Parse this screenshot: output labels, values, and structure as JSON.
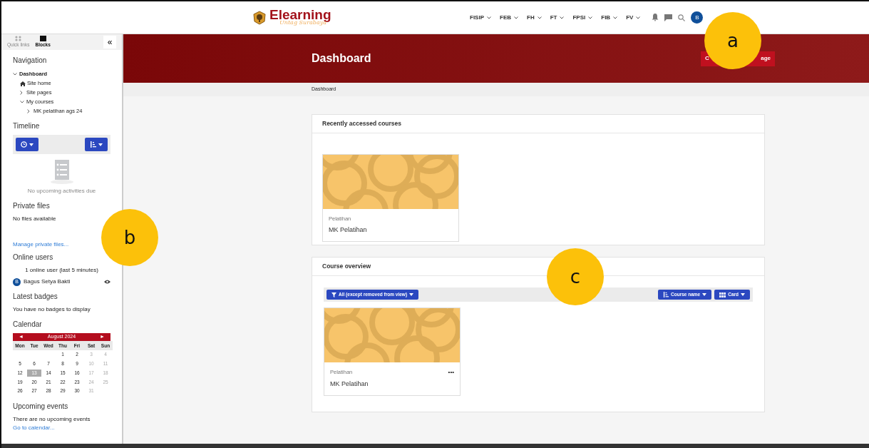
{
  "brand": {
    "name": "Elearning",
    "tagline": "Untag Surabaya"
  },
  "topnav": [
    {
      "label": "FISIP"
    },
    {
      "label": "FEB"
    },
    {
      "label": "FH"
    },
    {
      "label": "FT"
    },
    {
      "label": "FPSI"
    },
    {
      "label": "FIB"
    },
    {
      "label": "FV"
    }
  ],
  "user_avatar": "B",
  "drawer_tabs": [
    {
      "label": "Quick links",
      "selected": false
    },
    {
      "label": "Blocks",
      "selected": true
    }
  ],
  "drawer_close": "«",
  "navigation": {
    "title": "Navigation",
    "items": [
      {
        "label": "Dashboard",
        "expanded": true,
        "bold": true,
        "kind": "branch",
        "children": [
          {
            "label": "Site home",
            "kind": "home"
          },
          {
            "label": "Site pages",
            "expanded": false,
            "kind": "branch"
          },
          {
            "label": "My courses",
            "expanded": true,
            "kind": "branch",
            "children": [
              {
                "label": "MK pelatihan ags 24",
                "expanded": false,
                "kind": "branch"
              }
            ]
          }
        ]
      }
    ]
  },
  "timeline": {
    "title": "Timeline",
    "empty": "No upcoming activities due"
  },
  "private_files": {
    "title": "Private files",
    "empty": "No files available",
    "link": "Manage private files..."
  },
  "online_users": {
    "title": "Online users",
    "summary": "1 online user (last 5 minutes)",
    "users": [
      {
        "initial": "B",
        "name": "Bagus Setya Bakti"
      }
    ]
  },
  "badges": {
    "title": "Latest badges",
    "empty": "You have no badges to display"
  },
  "calendar": {
    "title": "Calendar",
    "prev": "◄",
    "month": "August 2024",
    "next": "►",
    "weekdays": [
      "Mon",
      "Tue",
      "Wed",
      "Thu",
      "Fri",
      "Sat",
      "Sun"
    ],
    "weeks": [
      [
        {
          "d": "1",
          "today": false
        },
        {
          "d": "2",
          "today": false
        },
        {
          "d": "3",
          "today": false
        },
        {
          "d": "4",
          "today": false
        }
      ],
      [
        {
          "d": "5",
          "today": false
        },
        {
          "d": "6",
          "today": false
        },
        {
          "d": "7",
          "today": false
        },
        {
          "d": "8",
          "today": false
        },
        {
          "d": "9",
          "today": false
        },
        {
          "d": "10",
          "today": false
        },
        {
          "d": "11",
          "today": false
        }
      ],
      [
        {
          "d": "12",
          "today": false
        },
        {
          "d": "13",
          "today": true
        },
        {
          "d": "14",
          "today": false
        },
        {
          "d": "15",
          "today": false
        },
        {
          "d": "16",
          "today": false
        },
        {
          "d": "17",
          "today": false
        },
        {
          "d": "18",
          "today": false
        }
      ],
      [
        {
          "d": "19",
          "today": false
        },
        {
          "d": "20",
          "today": false
        },
        {
          "d": "21",
          "today": false
        },
        {
          "d": "22",
          "today": false
        },
        {
          "d": "23",
          "today": false
        },
        {
          "d": "24",
          "today": false
        },
        {
          "d": "25",
          "today": false
        }
      ],
      [
        {
          "d": "26",
          "today": false
        },
        {
          "d": "27",
          "today": false
        },
        {
          "d": "28",
          "today": false
        },
        {
          "d": "29",
          "today": false
        },
        {
          "d": "30",
          "today": false
        },
        {
          "d": "31",
          "today": false
        }
      ]
    ]
  },
  "upcoming": {
    "title": "Upcoming events",
    "empty": "There are no upcoming events",
    "link": "Go to calendar..."
  },
  "header": {
    "title": "Dashboard",
    "button_left": "C",
    "button_right": "age"
  },
  "breadcrumb": [
    "Dashboard"
  ],
  "recent": {
    "title": "Recently accessed courses",
    "courses": [
      {
        "category": "Pelatihan",
        "name": "MK Pelatihan"
      }
    ]
  },
  "overview": {
    "title": "Course overview",
    "filter": "All (except removed from view)",
    "sort": "Course name",
    "view": "Card",
    "courses": [
      {
        "category": "Pelatihan",
        "name": "MK Pelatihan",
        "menu": "•••"
      }
    ]
  },
  "callouts": [
    {
      "label": "a"
    },
    {
      "label": "b"
    },
    {
      "label": "c"
    }
  ]
}
